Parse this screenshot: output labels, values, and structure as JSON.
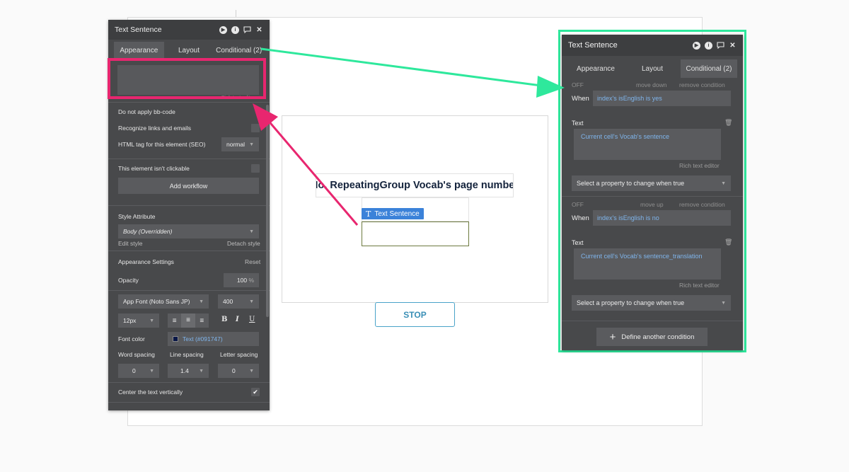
{
  "canvas": {
    "heading_text": "No. RepeatingGroup Vocab's page number",
    "selected_label": "Text Sentence",
    "stop_label": "STOP"
  },
  "left_panel": {
    "title": "Text Sentence",
    "tabs": [
      "Appearance",
      "Layout",
      "Conditional (2)"
    ],
    "rich_text_label": "Rich text editor",
    "no_bbcode": "Do not apply bb-code",
    "recognize_links": "Recognize links and emails",
    "html_tag_label": "HTML tag for this element (SEO)",
    "html_tag_value": "normal",
    "not_clickable": "This element isn't clickable",
    "add_workflow": "Add workflow",
    "style_attr": "Style Attribute",
    "style_value": "Body (Overridden)",
    "edit_style": "Edit style",
    "detach_style": "Detach style",
    "appearance_settings": "Appearance Settings",
    "reset": "Reset",
    "opacity_label": "Opacity",
    "opacity_value": "100",
    "opacity_unit": "%",
    "font_family": "App Font (Noto Sans JP)",
    "font_weight": "400",
    "font_size": "12px",
    "bold": "B",
    "italic": "I",
    "underline": "U",
    "font_color_label": "Font color",
    "font_color_value": "Text (#091747)",
    "font_color_hex": "#091747",
    "word_spacing_label": "Word spacing",
    "line_spacing_label": "Line spacing",
    "letter_spacing_label": "Letter spacing",
    "word_spacing": "0",
    "line_spacing": "1.4",
    "letter_spacing": "0",
    "center_vert": "Center the text vertically"
  },
  "right_panel": {
    "title": "Text Sentence",
    "tabs": [
      "Appearance",
      "Layout",
      "Conditional (2)"
    ],
    "conditions": [
      {
        "state": "OFF",
        "move_label": "move down",
        "remove_label": "remove condition",
        "when_label": "When",
        "expression": "index's isEnglish is yes",
        "text_label": "Text",
        "text_value": "Current cell's Vocab's sentence",
        "rich_label": "Rich text editor",
        "select_label": "Select a property to change when true"
      },
      {
        "state": "OFF",
        "move_label": "move up",
        "remove_label": "remove condition",
        "when_label": "When",
        "expression": "index's isEnglish is no",
        "text_label": "Text",
        "text_value": "Current cell's Vocab's sentence_translation",
        "rich_label": "Rich text editor",
        "select_label": "Select a property to change when true"
      }
    ],
    "define_another": "Define another condition"
  },
  "colors": {
    "highlight_pink": "#e8266f",
    "highlight_green": "#2ee89c",
    "panel_bg": "#48494b",
    "accent_blue": "#3b82d9"
  }
}
